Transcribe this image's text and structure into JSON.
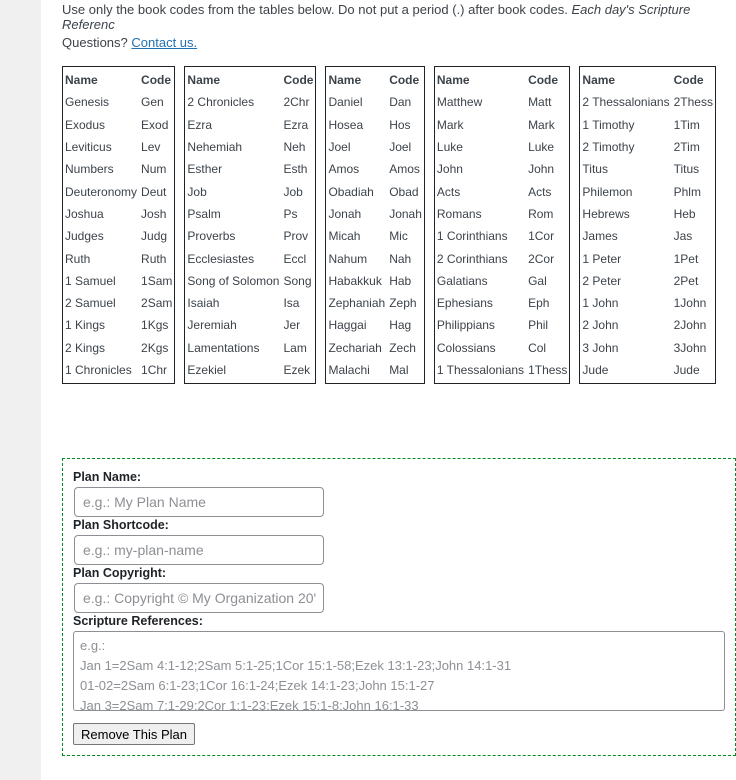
{
  "intro": {
    "text": "Use only the book codes from the tables below. Do not put a period (.) after book codes.",
    "italic": "Each day's Scripture Referenc",
    "questions": "Questions?",
    "contact_link": "Contact us."
  },
  "book_tables": [
    {
      "headers": [
        "Name",
        "Code"
      ],
      "rows": [
        [
          "Genesis",
          "Gen"
        ],
        [
          "Exodus",
          "Exod"
        ],
        [
          "Leviticus",
          "Lev"
        ],
        [
          "Numbers",
          "Num"
        ],
        [
          "Deuteronomy",
          "Deut"
        ],
        [
          "Joshua",
          "Josh"
        ],
        [
          "Judges",
          "Judg"
        ],
        [
          "Ruth",
          "Ruth"
        ],
        [
          "1 Samuel",
          "1Sam"
        ],
        [
          "2 Samuel",
          "2Sam"
        ],
        [
          "1 Kings",
          "1Kgs"
        ],
        [
          "2 Kings",
          "2Kgs"
        ],
        [
          "1 Chronicles",
          "1Chr"
        ]
      ]
    },
    {
      "headers": [
        "Name",
        "Code"
      ],
      "rows": [
        [
          "2 Chronicles",
          "2Chr"
        ],
        [
          "Ezra",
          "Ezra"
        ],
        [
          "Nehemiah",
          "Neh"
        ],
        [
          "Esther",
          "Esth"
        ],
        [
          "Job",
          "Job"
        ],
        [
          "Psalm",
          "Ps"
        ],
        [
          "Proverbs",
          "Prov"
        ],
        [
          "Ecclesiastes",
          "Eccl"
        ],
        [
          "Song of Solomon",
          "Song"
        ],
        [
          "Isaiah",
          "Isa"
        ],
        [
          "Jeremiah",
          "Jer"
        ],
        [
          "Lamentations",
          "Lam"
        ],
        [
          "Ezekiel",
          "Ezek"
        ]
      ]
    },
    {
      "headers": [
        "Name",
        "Code"
      ],
      "rows": [
        [
          "Daniel",
          "Dan"
        ],
        [
          "Hosea",
          "Hos"
        ],
        [
          "Joel",
          "Joel"
        ],
        [
          "Amos",
          "Amos"
        ],
        [
          "Obadiah",
          "Obad"
        ],
        [
          "Jonah",
          "Jonah"
        ],
        [
          "Micah",
          "Mic"
        ],
        [
          "Nahum",
          "Nah"
        ],
        [
          "Habakkuk",
          "Hab"
        ],
        [
          "Zephaniah",
          "Zeph"
        ],
        [
          "Haggai",
          "Hag"
        ],
        [
          "Zechariah",
          "Zech"
        ],
        [
          "Malachi",
          "Mal"
        ]
      ]
    },
    {
      "headers": [
        "Name",
        "Code"
      ],
      "rows": [
        [
          "Matthew",
          "Matt"
        ],
        [
          "Mark",
          "Mark"
        ],
        [
          "Luke",
          "Luke"
        ],
        [
          "John",
          "John"
        ],
        [
          "Acts",
          "Acts"
        ],
        [
          "Romans",
          "Rom"
        ],
        [
          "1 Corinthians",
          "1Cor"
        ],
        [
          "2 Corinthians",
          "2Cor"
        ],
        [
          "Galatians",
          "Gal"
        ],
        [
          "Ephesians",
          "Eph"
        ],
        [
          "Philippians",
          "Phil"
        ],
        [
          "Colossians",
          "Col"
        ],
        [
          "1 Thessalonians",
          "1Thess"
        ]
      ]
    },
    {
      "headers": [
        "Name",
        "Code"
      ],
      "rows": [
        [
          "2 Thessalonians",
          "2Thess"
        ],
        [
          "1 Timothy",
          "1Tim"
        ],
        [
          "2 Timothy",
          "2Tim"
        ],
        [
          "Titus",
          "Titus"
        ],
        [
          "Philemon",
          "Phlm"
        ],
        [
          "Hebrews",
          "Heb"
        ],
        [
          "James",
          "Jas"
        ],
        [
          "1 Peter",
          "1Pet"
        ],
        [
          "2 Peter",
          "2Pet"
        ],
        [
          "1 John",
          "1John"
        ],
        [
          "2 John",
          "2John"
        ],
        [
          "3 John",
          "3John"
        ],
        [
          "Jude",
          "Jude"
        ]
      ]
    }
  ],
  "plan_form": {
    "name_label": "Plan Name:",
    "name_placeholder": "e.g.: My Plan Name",
    "shortcode_label": "Plan Shortcode:",
    "shortcode_placeholder": "e.g.: my-plan-name",
    "copyright_label": "Plan Copyright:",
    "copyright_placeholder": "e.g.: Copyright © My Organization 20'",
    "refs_label": "Scripture References:",
    "refs_placeholder_lines": [
      "e.g.:",
      "Jan 1=2Sam 4:1-12;2Sam 5:1-25;1Cor 15:1-58;Ezek 13:1-23;John 14:1-31",
      "01-02=2Sam 6:1-23;1Cor 16:1-24;Ezek 14:1-23;John 15:1-27",
      "Jan 3=2Sam 7:1-29;2Cor 1:1-23;Ezek 15:1-8;John 16:1-33"
    ],
    "remove_button": "Remove This Plan"
  },
  "colors": {
    "link": "#2271b1",
    "plan_border": "#008a20"
  }
}
